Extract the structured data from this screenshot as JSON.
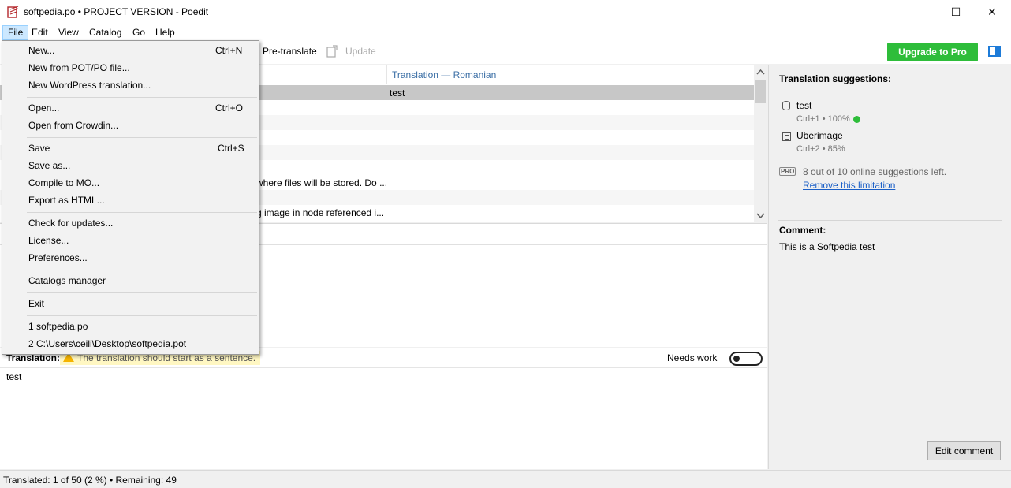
{
  "window": {
    "title": "softpedia.po • PROJECT VERSION - Poedit",
    "minimize_glyph": "—",
    "maximize_glyph": "☐",
    "close_glyph": "✕"
  },
  "menubar": [
    "File",
    "Edit",
    "View",
    "Catalog",
    "Go",
    "Help"
  ],
  "toolbar": {
    "pretranslate_label": "Pre-translate",
    "update_label": "Update",
    "upgrade_label": "Upgrade to Pro",
    "upgrade_color": "#2ebd3a"
  },
  "list": {
    "columns": [
      "Translation — Romanian"
    ],
    "rows": [
      {
        "source": "",
        "translation": "test"
      },
      {
        "source": "",
        "translation": ""
      },
      {
        "source": "",
        "translation": ""
      },
      {
        "source": "",
        "translation": ""
      },
      {
        "source": "",
        "translation": ""
      },
      {
        "source": "",
        "translation": ""
      },
      {
        "source": "where files will be stored. Do ...",
        "translation": ""
      },
      {
        "source": "",
        "translation": ""
      },
      {
        "source": "g image in node referenced i...",
        "translation": ""
      }
    ]
  },
  "translation_bar": {
    "label": "Translation:",
    "warning": "The translation should start as a sentence.",
    "needs_work_label": "Needs work",
    "value": "test"
  },
  "sidebar": {
    "suggestions_title": "Translation suggestions:",
    "suggestions": [
      {
        "text": "test",
        "meta": "Ctrl+1 • 100%"
      },
      {
        "text": "Uberimage",
        "meta": "Ctrl+2 • 85%"
      }
    ],
    "pro_badge": "PRO",
    "online_left": "8 out of 10 online suggestions left.",
    "remove_limitation": "Remove this limitation",
    "comment_title": "Comment:",
    "comment_text": "This is a Softpedia test",
    "edit_comment_label": "Edit comment"
  },
  "status": {
    "text": "Translated: 1 of 50 (2 %)  •  Remaining: 49"
  },
  "file_menu": {
    "items": [
      {
        "label": "New...",
        "shortcut": "Ctrl+N"
      },
      {
        "label": "New from POT/PO file...",
        "shortcut": ""
      },
      {
        "label": "New WordPress translation...",
        "shortcut": ""
      },
      {
        "label": "Open...",
        "shortcut": "Ctrl+O"
      },
      {
        "label": "Open from Crowdin...",
        "shortcut": ""
      },
      {
        "label": "Save",
        "shortcut": "Ctrl+S"
      },
      {
        "label": "Save as...",
        "shortcut": ""
      },
      {
        "label": "Compile to MO...",
        "shortcut": ""
      },
      {
        "label": "Export as HTML...",
        "shortcut": ""
      },
      {
        "label": "Check for updates...",
        "shortcut": ""
      },
      {
        "label": "License...",
        "shortcut": ""
      },
      {
        "label": "Preferences...",
        "shortcut": ""
      },
      {
        "label": "Catalogs manager",
        "shortcut": ""
      },
      {
        "label": "Exit",
        "shortcut": ""
      },
      {
        "label": "1 softpedia.po",
        "shortcut": ""
      },
      {
        "label": "2 C:\\Users\\ceili\\Desktop\\softpedia.pot",
        "shortcut": ""
      }
    ]
  }
}
